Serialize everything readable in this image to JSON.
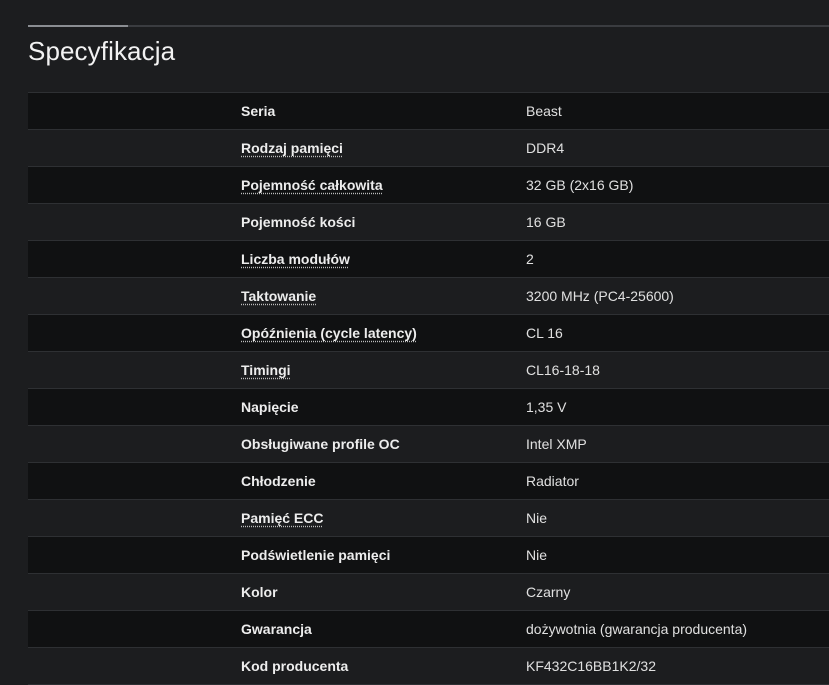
{
  "section": {
    "title": "Specyfikacja"
  },
  "specs": [
    {
      "label": "Seria",
      "value": "Beast",
      "link": false
    },
    {
      "label": "Rodzaj pamięci",
      "value": "DDR4",
      "link": true
    },
    {
      "label": "Pojemność całkowita",
      "value": "32 GB (2x16 GB)",
      "link": true
    },
    {
      "label": "Pojemność kości",
      "value": "16 GB",
      "link": false
    },
    {
      "label": "Liczba modułów",
      "value": "2",
      "link": true
    },
    {
      "label": "Taktowanie",
      "value": "3200 MHz (PC4-25600)",
      "link": true
    },
    {
      "label": "Opóźnienia (cycle latency)",
      "value": "CL 16",
      "link": true
    },
    {
      "label": "Timingi",
      "value": "CL16-18-18",
      "link": true
    },
    {
      "label": "Napięcie",
      "value": "1,35 V",
      "link": false
    },
    {
      "label": "Obsługiwane profile OC",
      "value": "Intel XMP",
      "link": false
    },
    {
      "label": "Chłodzenie",
      "value": "Radiator",
      "link": false
    },
    {
      "label": "Pamięć ECC",
      "value": "Nie",
      "link": true
    },
    {
      "label": "Podświetlenie pamięci",
      "value": "Nie",
      "link": false
    },
    {
      "label": "Kolor",
      "value": "Czarny",
      "link": false
    },
    {
      "label": "Gwarancja",
      "value": "dożywotnia (gwarancja producenta)",
      "link": false
    },
    {
      "label": "Kod producenta",
      "value": "KF432C16BB1K2/32",
      "link": false
    }
  ]
}
